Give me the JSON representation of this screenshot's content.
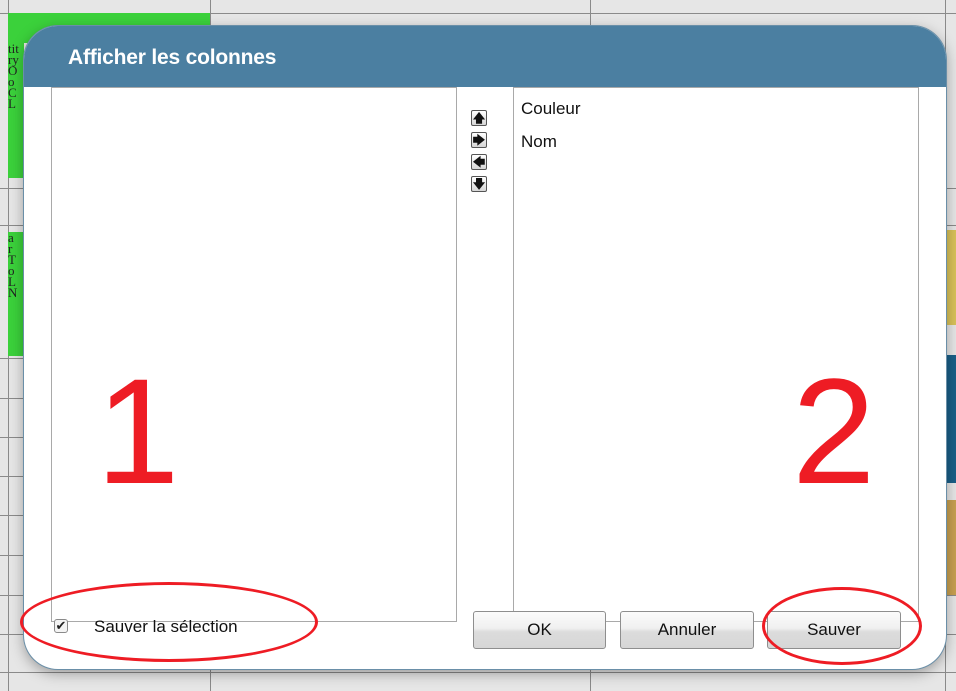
{
  "background": {
    "left_column_text_1": [
      "tit",
      "ry",
      "O",
      "o",
      "C",
      "L"
    ],
    "left_column_text_2": [
      "a",
      "r",
      "T",
      "o",
      "L",
      "N"
    ]
  },
  "dialog": {
    "title": "Afficher les colonnes",
    "available_columns": [],
    "visible_columns": [
      "Couleur",
      "Nom"
    ],
    "move_buttons": [
      {
        "name": "move-up-icon",
        "glyph": "🡅"
      },
      {
        "name": "move-right-icon",
        "glyph": "🡆"
      },
      {
        "name": "move-left-icon",
        "glyph": "🡄"
      },
      {
        "name": "move-down-icon",
        "glyph": "🡇"
      }
    ],
    "save_selection_checked": true,
    "save_selection_label": "Sauver la sélection",
    "ok_label": "OK",
    "cancel_label": "Annuler",
    "save_label": "Sauver"
  },
  "annotations": {
    "number_left": "1",
    "number_right": "2",
    "color": "#ee1c24"
  },
  "colors": {
    "header": "#4b7fa1",
    "green_cell": "#3bd13b",
    "yellow_chip": "#d9c25a",
    "blue_chip": "#1a5f87",
    "orange_chip": "#c8a050"
  }
}
